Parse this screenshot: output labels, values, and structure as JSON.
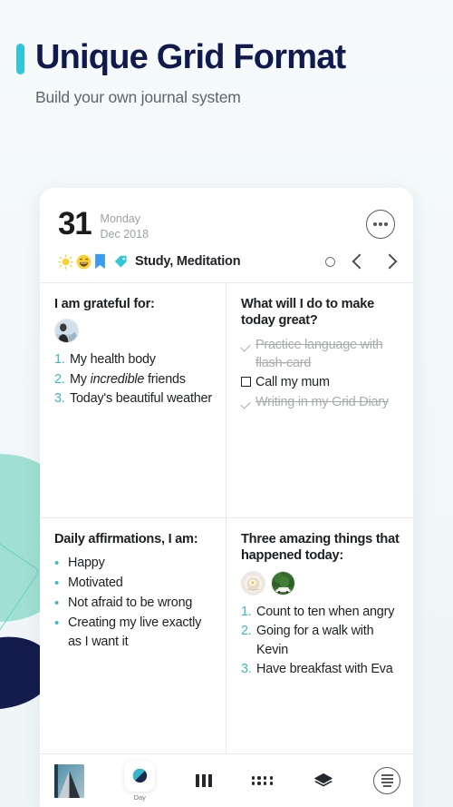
{
  "header": {
    "title": "Unique Grid Format",
    "subtitle": "Build your own journal system",
    "accent_color": "#2fc6d8",
    "title_color": "#111a4e"
  },
  "page": {
    "background_color": "#f3f8f9",
    "decorations": [
      "mint-circle",
      "teal-outline-square",
      "navy-blob"
    ]
  },
  "entry": {
    "day_number": "31",
    "weekday": "Monday",
    "month_year": "Dec 2018",
    "more_button": "•••",
    "tags_text": "Study, Meditation",
    "icons": [
      "sun-icon",
      "smiley-icon",
      "bookmark-icon",
      "tag-icon"
    ],
    "pager": {
      "circle": "circle-icon",
      "prev": "chevron-left-icon",
      "next": "chevron-right-icon"
    }
  },
  "cells": {
    "grateful": {
      "title": "I am grateful for:",
      "thumbnails": [
        "person-photo-thumbnail"
      ],
      "items": [
        {
          "n": "1.",
          "text": "My health body"
        },
        {
          "n": "2.",
          "pre": "My ",
          "italic": "incredible",
          "post": " friends"
        },
        {
          "n": "3.",
          "text": "Today's beautiful weather"
        }
      ]
    },
    "today_great": {
      "title": "What will I do to make today great?",
      "items": [
        {
          "mark": "check",
          "text": "Practice language with flash-card",
          "done": true
        },
        {
          "mark": "box",
          "text": "Call my mum",
          "done": false
        },
        {
          "mark": "check",
          "text": "Writing in my Grid Diary",
          "done": true
        }
      ]
    },
    "affirmations": {
      "title": "Daily affirmations, I am:",
      "bullet": "•",
      "items": [
        "Happy",
        "Motivated",
        "Not afraid to be wrong",
        "Creating my live exactly as I want it"
      ]
    },
    "amazing": {
      "title": "Three amazing things that happened today:",
      "thumbnails": [
        "food-plate-photo-thumbnail",
        "car-greenery-photo-thumbnail"
      ],
      "items": [
        {
          "n": "1.",
          "text": "Count to ten when angry"
        },
        {
          "n": "2.",
          "text": "Going for a walk with Kevin"
        },
        {
          "n": "3.",
          "text": "Have breakfast with Eva"
        }
      ]
    }
  },
  "bottom_nav": {
    "app_icon": "app-logo-icon",
    "items": [
      {
        "icon": "day-view-icon",
        "label": "Day",
        "selected": true
      },
      {
        "icon": "week-view-icon",
        "label": "",
        "selected": false
      },
      {
        "icon": "month-view-icon",
        "label": "",
        "selected": false
      },
      {
        "icon": "layers-icon",
        "label": "",
        "selected": false
      },
      {
        "icon": "list-menu-icon",
        "label": "",
        "selected": false
      }
    ]
  }
}
